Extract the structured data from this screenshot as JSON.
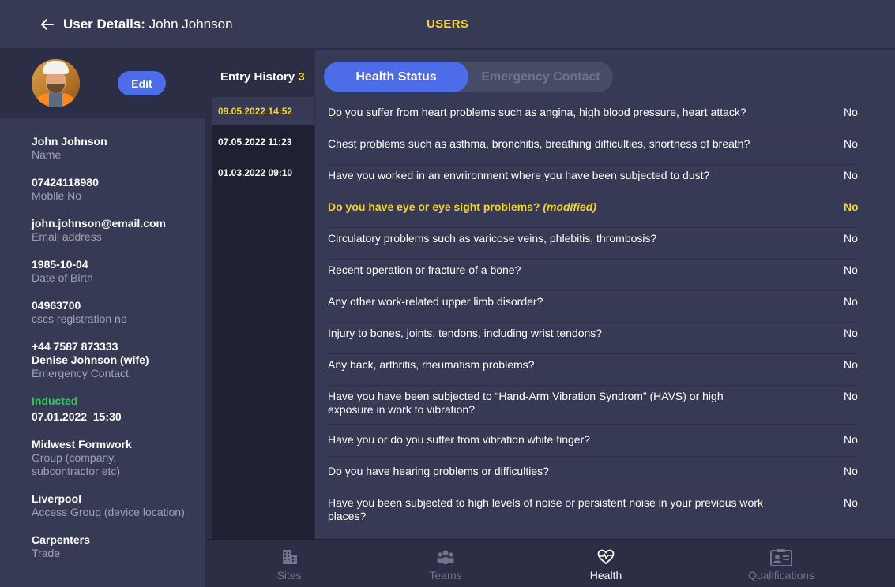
{
  "header": {
    "title_prefix": "User Details:",
    "title_name": "John Johnson",
    "section": "USERS"
  },
  "sidebar": {
    "edit_label": "Edit",
    "fields": {
      "name": {
        "value": "John Johnson",
        "label": "Name"
      },
      "mobile": {
        "value": "07424118980",
        "label": "Mobile No"
      },
      "email": {
        "value": "john.johnson@email.com",
        "label": "Email address"
      },
      "dob": {
        "value": "1985-10-04",
        "label": "Date of Birth"
      },
      "cscs": {
        "value": "04963700",
        "label": "cscs registration no"
      },
      "emergency": {
        "phone": "+44 7587 873333",
        "contact": "Denise Johnson (wife)",
        "label": "Emergency Contact"
      },
      "inducted": {
        "status": "Inducted",
        "datetime": "07.01.2022  15:30"
      },
      "group": {
        "value": "Midwest Formwork",
        "label_line1": "Group (company,",
        "label_line2": "subcontractor etc)"
      },
      "access": {
        "value": "Liverpool",
        "label": "Access Group (device location)"
      },
      "trade": {
        "value": "Carpenters",
        "label": "Trade"
      }
    }
  },
  "history": {
    "title": "Entry History",
    "count": "3",
    "entries": [
      "09.05.2022 14:52",
      "07.05.2022 11:23",
      "01.03.2022 09:10"
    ]
  },
  "tabs": {
    "health": "Health Status",
    "emergency": "Emergency Contact"
  },
  "questions": [
    {
      "text": "Do you suffer from heart problems such as angina, high blood pressure, heart attack?",
      "answer": "No"
    },
    {
      "text": "Chest problems such as asthma, bronchitis, breathing difficulties, shortness of breath?",
      "answer": "No"
    },
    {
      "text": "Have you worked in an envrironment where you have been subjected to dust?",
      "answer": "No"
    },
    {
      "text": "Do you have eye or eye sight problems?",
      "modified": "(modified)",
      "answer": "No"
    },
    {
      "text": "Circulatory problems such as varicose veins, phlebitis, thrombosis?",
      "answer": "No"
    },
    {
      "text": "Recent operation or fracture of a bone?",
      "answer": "No"
    },
    {
      "text": "Any other work-related upper limb disorder?",
      "answer": "No"
    },
    {
      "text": "Injury to bones, joints, tendons, including wrist tendons?",
      "answer": "No"
    },
    {
      "text": "Any back, arthritis, rheumatism problems?",
      "answer": "No"
    },
    {
      "text": "Have you have been subjected to “Hand-Arm Vibration Syndrom” (HAVS) or high exposure in work to vibration?",
      "answer": "No"
    },
    {
      "text": "Have you or do you suffer from vibration white finger?",
      "answer": "No"
    },
    {
      "text": "Do you have hearing problems or difficulties?",
      "answer": "No"
    },
    {
      "text": "Have you been subjected to high levels of noise or persistent noise in your previous work places?",
      "answer": "No"
    }
  ],
  "nav": {
    "sites": "Sites",
    "teams": "Teams",
    "health": "Health",
    "qualifications": "Qualifications"
  },
  "colors": {
    "accent_blue": "#4d6ce8",
    "highlight_yellow": "#f6d22b",
    "inducted_green": "#37c55a",
    "panel": "#363a55",
    "background": "#2b2e44"
  },
  "icons": [
    "back-arrow-icon",
    "building-icon",
    "team-icon",
    "heart-pulse-icon",
    "id-card-icon"
  ]
}
